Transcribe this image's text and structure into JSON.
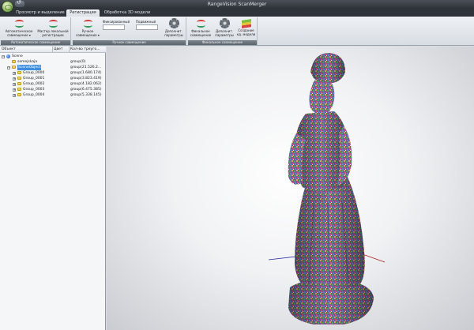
{
  "window": {
    "title": "RangeVision ScanMerger"
  },
  "tabs": [
    {
      "label": "Просмотр и выделение"
    },
    {
      "label": "Регистрация"
    },
    {
      "label": "Обработка 3D модели"
    }
  ],
  "ribbon": {
    "auto_group": {
      "caption": "Автоматическое совмещение",
      "auto_button": [
        "Автоматическое",
        "совмещение ▾"
      ],
      "master_button": [
        "Мастер локальной",
        "регистрации"
      ]
    },
    "manual_group": {
      "caption": "Ручное совмещение",
      "manual_button": [
        "Ручное",
        "совмещение ▾"
      ],
      "fixed_label": "Фиксированный",
      "moving_label": "Подвижный",
      "extra_button": [
        "Дополнит.",
        "параметры"
      ]
    },
    "final_group": {
      "caption": "Финальное совмещение",
      "final_button": [
        "Финальное",
        "совмещение"
      ],
      "extra_button": [
        "Дополнит.",
        "параметры"
      ],
      "create_button": [
        "Создание",
        "кд. модели"
      ]
    }
  },
  "tree": {
    "columns": {
      "object": "Объект",
      "color": "Цвет",
      "count": "Кол-во треуго..."
    },
    "rows": [
      {
        "label": "Scene",
        "count": ""
      },
      {
        "label": "semejskaja",
        "count": "group(0)"
      },
      {
        "label": "SceneObject",
        "count": "group(21.526.2..."
      },
      {
        "label": "Group_0000",
        "count": "group(1.680.174)"
      },
      {
        "label": "Group_0001",
        "count": "group(3.823.419)"
      },
      {
        "label": "Group_0002",
        "count": "group(4.182.062)"
      },
      {
        "label": "Group_0003",
        "count": "group(6.475.385)"
      },
      {
        "label": "Group_0004",
        "count": "group(5.338.145)"
      }
    ]
  },
  "colors": {
    "accent": "#3d8ee0",
    "titlebar": "#2e3238",
    "selection": "#3d8ee0"
  }
}
